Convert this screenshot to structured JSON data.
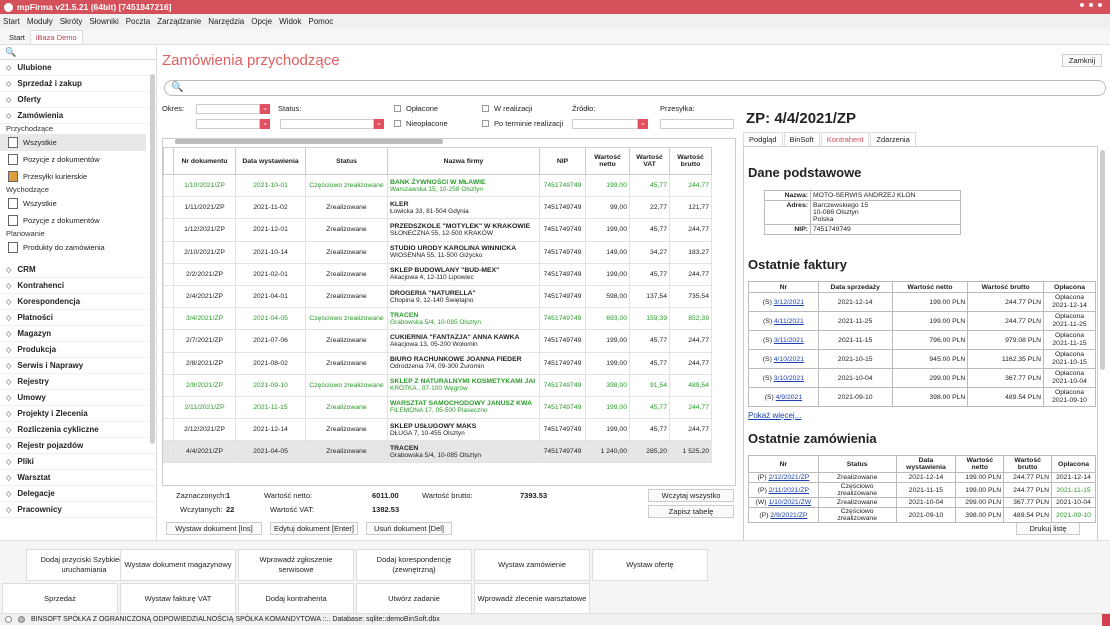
{
  "window": {
    "title": "mpFirma v21.5.21 (64bit) [7451847216]"
  },
  "menu": [
    "Start",
    "Moduły",
    "Skróty",
    "Słowniki",
    "Poczta",
    "Zarządzanie",
    "Narzędzia",
    "Opcje",
    "Widok",
    "Pomoc"
  ],
  "tabs": [
    "Start",
    "iBaza Demo"
  ],
  "sidebar": {
    "search_glyph": "🔍",
    "groups_top": [
      "Ulubione",
      "Sprzedaż i zakup",
      "Oferty",
      "Zamówienia"
    ],
    "sections": [
      {
        "head": "Przychodzące",
        "items": [
          "Wszystkie",
          "Pozycje z dokumentów",
          "Przesyłki kurierskie"
        ]
      },
      {
        "head": "Wychodzące",
        "items": [
          "Wszystkie",
          "Pozycje z dokumentów"
        ]
      },
      {
        "head": "Planowanie",
        "items": [
          "Produkty do zamówienia"
        ]
      }
    ],
    "groups_bottom": [
      "CRM",
      "Kontrahenci",
      "Korespondencja",
      "Płatności",
      "Magazyn",
      "Produkcja",
      "Serwis i Naprawy",
      "Rejestry",
      "Umowy",
      "Projekty i Zlecenia",
      "Rozliczenia cykliczne",
      "Rejestr pojazdów",
      "Pliki",
      "Warsztat",
      "Delegacje",
      "Pracownicy"
    ]
  },
  "main": {
    "title": "Zamówienia przychodzące",
    "close_label": "Zamknij",
    "filters": {
      "okres": "Okres:",
      "status": "Status:",
      "oplacone": "Opłacone",
      "nieoplacone": "Nieopłacone",
      "w_realizacji": "W realizacji",
      "po_terminie": "Po terminie realizacji",
      "zrodlo": "Źródło:",
      "przesylka": "Przesyłka:"
    },
    "table": {
      "headers": [
        "Nr dokumentu",
        "Data wystawienia",
        "Status",
        "Nazwa firmy",
        "NIP",
        "Wartość netto",
        "Wartość VAT",
        "Wartość brutto"
      ],
      "rows": [
        {
          "nr": "1/10/2021/ZP",
          "data": "2021-10-01",
          "status": "Częściowo zrealizowane",
          "nazwa": "BANK ŻYWNOŚCI W MŁAWIE",
          "adres": "Warszawska 15, 10-258 Olsztyn",
          "nip": "7451749749",
          "netto": "199,00",
          "vat": "45,77",
          "brutto": "244,77",
          "green": true
        },
        {
          "nr": "1/11/2021/ZP",
          "data": "2021-11-02",
          "status": "Zrealizowane",
          "nazwa": "KLER",
          "adres": "Łowicka 33, 81-504 Gdynia",
          "nip": "7451749749",
          "netto": "99,00",
          "vat": "22,77",
          "brutto": "121,77",
          "green": false
        },
        {
          "nr": "1/12/2021/ZP",
          "data": "2021-12-01",
          "status": "Zrealizowane",
          "nazwa": "PRZEDSZKOLE \"MOTYLEK\" W KRAKOWIE",
          "adres": "SŁONECZNA 55, 12-500 KRAKÓW",
          "nip": "7451749749",
          "netto": "199,00",
          "vat": "45,77",
          "brutto": "244,77",
          "green": false
        },
        {
          "nr": "2/10/2021/ZP",
          "data": "2021-10-14",
          "status": "Zrealizowane",
          "nazwa": "STUDIO URODY KAROLINA WINNICKA",
          "adres": "WIOSENNA 55, 11-500 Giżycko",
          "nip": "7451749749",
          "netto": "149,00",
          "vat": "34,27",
          "brutto": "183,27",
          "green": false
        },
        {
          "nr": "2/2/2021/ZP",
          "data": "2021-02-01",
          "status": "Zrealizowane",
          "nazwa": "SKLEP BUDOWLANY \"BUD-MEX\"",
          "adres": "Akacjowa 4, 12-110 Lipowiec",
          "nip": "7451749749",
          "netto": "199,00",
          "vat": "45,77",
          "brutto": "244,77",
          "green": false
        },
        {
          "nr": "2/4/2021/ZP",
          "data": "2021-04-01",
          "status": "Zrealizowane",
          "nazwa": "DROGERIA \"NATURELLA\"",
          "adres": "Chopina 9, 12-140 Świętajno",
          "nip": "7451749749",
          "netto": "598,00",
          "vat": "137,54",
          "brutto": "735,54",
          "green": false
        },
        {
          "nr": "3/4/2021/ZP",
          "data": "2021-04-05",
          "status": "Częściowo zrealizowane",
          "nazwa": "TRACEN",
          "adres": "Grabowska 5/4, 10-085 Olsztyn",
          "nip": "7451749749",
          "netto": "693,00",
          "vat": "159,39",
          "brutto": "852,39",
          "green": true
        },
        {
          "nr": "2/7/2021/ZP",
          "data": "2021-07-06",
          "status": "Zrealizowane",
          "nazwa": "CUKIERNIA \"FANTAZJA\" ANNA KAWKA",
          "adres": "Akacjowa 13, 05-200 Wołomin",
          "nip": "7451749749",
          "netto": "199,00",
          "vat": "45,77",
          "brutto": "244,77",
          "green": false
        },
        {
          "nr": "2/8/2021/ZP",
          "data": "2021-08-02",
          "status": "Zrealizowane",
          "nazwa": "BIURO RACHUNKOWE JOANNA FIEDER",
          "adres": "Odrodzenia 7/4, 09-300 Żuromin",
          "nip": "7451749749",
          "netto": "199,00",
          "vat": "45,77",
          "brutto": "244,77",
          "green": false
        },
        {
          "nr": "2/9/2021/ZP",
          "data": "2021-09-10",
          "status": "Częściowo zrealizowane",
          "nazwa": "SKLEP Z NATURALNYMI KOSMETYKAMI JAI",
          "adres": "KRÓTKA , 07-100 Węgrów",
          "nip": "7451749749",
          "netto": "398,00",
          "vat": "91,54",
          "brutto": "489,54",
          "green": true
        },
        {
          "nr": "2/11/2021/ZP",
          "data": "2021-11-15",
          "status": "Zrealizowane",
          "nazwa": "WARSZTAT SAMOCHODOWY JANUSZ KWA",
          "adres": "FILEMONA 17, 05-500 Piaseczno",
          "nip": "7451749749",
          "netto": "199,00",
          "vat": "45,77",
          "brutto": "244,77",
          "green": true
        },
        {
          "nr": "2/12/2021/ZP",
          "data": "2021-12-14",
          "status": "Zrealizowane",
          "nazwa": "SKLEP USŁUGOWY MAKS",
          "adres": "DŁUGA 7, 10-455 Olsztyn",
          "nip": "7451749749",
          "netto": "199,00",
          "vat": "45,77",
          "brutto": "244,77",
          "green": false
        },
        {
          "nr": "4/4/2021/ZP",
          "data": "2021-04-05",
          "status": "Zrealizowane",
          "nazwa": "TRACEN",
          "adres": "Grabowska 5/4, 10-085 Olsztyn",
          "nip": "7451749749",
          "netto": "1 240,00",
          "vat": "285,20",
          "brutto": "1 525,20",
          "green": false,
          "selected": true
        }
      ]
    },
    "summary": {
      "zaznaczonych_label": "Zaznaczonych:",
      "zaznaczonych": "1",
      "wczytanych_label": "Wczytanych:",
      "wczytanych": "22",
      "netto_label": "Wartość netto:",
      "netto": "6011.00",
      "vat_label": "Wartość VAT:",
      "vat": "1382.53",
      "brutto_label": "Wartość brutto:",
      "brutto": "7393.53",
      "wczytaj": "Wczytaj wszystko",
      "zapisz": "Zapisz tabelę"
    },
    "actions": {
      "wystaw": "Wystaw dokument [Ins]",
      "edytuj": "Edytuj dokument [Enter]",
      "usun": "Usuń dokument [Del]",
      "drukuj": "Drukuj listę"
    }
  },
  "detail": {
    "title": "ZP: 4/4/2021/ZP",
    "tabs": [
      "Podgląd",
      "BinSoft",
      "Kontrahent",
      "Zdarzenia"
    ],
    "dane_title": "Dane podstawowe",
    "nazwa_k": "Nazwa:",
    "nazwa_v": "MOTO-SERWIS ANDRZEJ KLON",
    "adres_k": "Adres:",
    "adres_1": "Barczewskiego 15",
    "adres_2": "10-086 Olsztyn",
    "adres_3": "Polska",
    "nip_k": "NIP:",
    "nip_v": "7451749749",
    "faktury_title": "Ostatnie faktury",
    "faktury_headers": [
      "Nr",
      "Data sprzedaży",
      "Wartość netto",
      "Wartość brutto",
      "Opłacona"
    ],
    "faktury": [
      {
        "p": "(S) ",
        "nr": "3/12/2021",
        "data": "2021-12-14",
        "netto": "199.00 PLN",
        "brutto": "244.77 PLN",
        "op": "Opłacona",
        "opd": "2021-12-14"
      },
      {
        "p": "(S) ",
        "nr": "4/11/2021",
        "data": "2021-11-25",
        "netto": "199.00 PLN",
        "brutto": "244.77 PLN",
        "op": "Opłacona",
        "opd": "2021-11-25"
      },
      {
        "p": "(S) ",
        "nr": "3/11/2021",
        "data": "2021-11-15",
        "netto": "796.00 PLN",
        "brutto": "979.08 PLN",
        "op": "Opłacona",
        "opd": "2021-11-15"
      },
      {
        "p": "(S) ",
        "nr": "4/10/2021",
        "data": "2021-10-15",
        "netto": "945.00 PLN",
        "brutto": "1162.35 PLN",
        "op": "Opłacona",
        "opd": "2021-10-15"
      },
      {
        "p": "(S) ",
        "nr": "3/10/2021",
        "data": "2021-10-04",
        "netto": "299.00 PLN",
        "brutto": "367.77 PLN",
        "op": "Opłacona",
        "opd": "2021-10-04"
      },
      {
        "p": "(S) ",
        "nr": "4/9/2021",
        "data": "2021-09-10",
        "netto": "398.00 PLN",
        "brutto": "489.54 PLN",
        "op": "Opłacona",
        "opd": "2021-09-10"
      }
    ],
    "pokaz": "Pokaż więcej...",
    "zam_title": "Ostatnie zamówienia",
    "zam_headers": [
      "Nr",
      "Status",
      "Data wystawienia",
      "Wartość netto",
      "Wartość brutto",
      "Opłacona"
    ],
    "zamowienia": [
      {
        "p": "(P) ",
        "nr": "2/12/2021/ZP",
        "status": "Zrealizowane",
        "data": "2021-12-14",
        "netto": "199.00 PLN",
        "brutto": "244.77 PLN",
        "op": "2021-12-14",
        "green": false
      },
      {
        "p": "(P) ",
        "nr": "2/11/2021/ZP",
        "status": "Częściowo zrealizowane",
        "data": "2021-11-15",
        "netto": "199.00 PLN",
        "brutto": "244.77 PLN",
        "op": "2021-11-15",
        "green": true
      },
      {
        "p": "(W) ",
        "nr": "1/10/2021/ZW",
        "status": "Zrealizowane",
        "data": "2021-10-04",
        "netto": "299.00 PLN",
        "brutto": "367.77 PLN",
        "op": "2021-10-04",
        "green": false
      },
      {
        "p": "(P) ",
        "nr": "2/9/2021/ZP",
        "status": "Częściowo zrealizowane",
        "data": "2021-09-10",
        "netto": "398.00 PLN",
        "brutto": "489.54 PLN",
        "op": "2021-09-10",
        "green": true
      }
    ]
  },
  "quick": [
    "Dodaj przyciski Szybkiego uruchamiania",
    "Wystaw dokument magazynowy",
    "Wprowadź zgłoszenie serwisowe",
    "Dodaj korespondencję (zewnętrzną)",
    "Wystaw zamówienie",
    "Wystaw ofertę",
    "Sprzedaż",
    "Wystaw fakturę VAT",
    "Dodaj kontrahenta",
    "Utwórz zadanie",
    "Wprowadź zlecenie warsztatowe"
  ],
  "status": {
    "text": "BINSOFT SPÓŁKA Z OGRANICZONĄ ODPOWIEDZIALNOŚCIĄ SPÓŁKA KOMANDYTOWA ::.. Database: sqlite::demoBinSoft.dbx"
  },
  "colors": {
    "accent": "#d4505a",
    "green": "#2a9a2a",
    "link": "#1a3fb0"
  }
}
